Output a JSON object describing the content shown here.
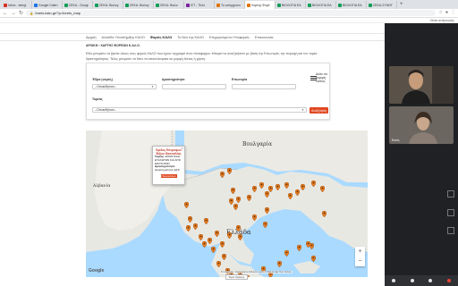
{
  "browser": {
    "tabs": [
      {
        "label": "Inbox - stergi",
        "color": "#d93025"
      },
      {
        "label": "Google Calen",
        "color": "#1a73e8"
      },
      {
        "label": "ΣΕΚΑ - Googl",
        "color": "#0f9d58"
      },
      {
        "label": "ΣΕΚΑ: Βιολογ",
        "color": "#0f9d58"
      },
      {
        "label": "ΣΕΚΑ: Βιολογ",
        "color": "#0f9d58"
      },
      {
        "label": "ΣΕΚΑ: Βιολο",
        "color": "#0f9d58"
      },
      {
        "label": "ΙΣΤ - Τίτλο",
        "color": "#7b1fa2"
      },
      {
        "label": "Το ασύγχρονο",
        "color": "#e37400"
      },
      {
        "label": "Χάρτης Φορέ",
        "color": "#e37400",
        "active": true
      },
      {
        "label": "ΒΙΟΛΟΓΙΑ ΕΑ",
        "color": "#0f9d58"
      },
      {
        "label": "ΒΙΟΛΟΓΙΑ ΕΑ",
        "color": "#0f9d58"
      },
      {
        "label": "ΒΙΟΛΟΓΙΑ ΕΑ",
        "color": "#0f9d58"
      },
      {
        "label": "ΣΕΚΑ-ΣΥΝΟΓ",
        "color": "#0f9d58"
      }
    ],
    "new_tab": "+",
    "url": "foreis.kalo.gr/?p=foreis_map",
    "bookmark": "Λίστα ανάγνωσης"
  },
  "site": {
    "menu": [
      "Αρχική",
      "Αλυσίδα Υποστήριξης ΚΑΛΟ",
      "Φορείς ΚΑΛΟ",
      "Το Νέο της ΚΑΛΟ",
      "Επιχειρούμενοι Υποφορείς",
      "Επικοινωνία"
    ],
    "active_menu": "Φορείς ΚΑΛΟ",
    "breadcrumb": "ΑΡΧΙΚΗ › ΧΑΡΤΗΣ ΦΟΡΕΩΝ Κ.ΑΛ.Ο.",
    "intro": "Εδώ μπορείτε να βρείτε όλους τους φορείς ΚΑΛΟ που έχουν εγγραφεί στον πλατφόρμα. Μπορεί να αναζητήσετε με βάση την Επωνυμία, την περιοχή και τον τομέα δραστηριότητας. Τέλος μπορείτε να δείτε τα αποτελέσματα σε μορφή λίστας ή χάρτη."
  },
  "filter": {
    "region_label": "Έδρα (νομός)",
    "region_value": "--Οποιαδήποτε--",
    "activity_label": "Δραστηριότητα",
    "activity_value": "",
    "name_label": "Επωνυμία",
    "name_value": "",
    "sector_label": "Τομέας",
    "sector_value": "--Οποιαδήποτε--",
    "search_button": "Αναζήτηση",
    "list_view": "Δείτε σε μορφή λίστας"
  },
  "map": {
    "labels": {
      "bulgaria": "Βουλγαρία",
      "albania": "Αλβανία",
      "greece": "Ελλάδα"
    },
    "popup": {
      "title": "Ομιλος Εκτροφών Βιζων Θεσσαλίας",
      "sector_label": "Τομέας:",
      "sector_value": "ΕΠΑΝΤΑΞΗ ΕΥΑΛΩΤΩΝ ΚΑΙ ΑΠΟ ΕΝΟΤΗΤΩΝ",
      "activity_label": "Δραστηριότητα:",
      "activity_value": "Δραστηριότητες ΕΚΚ",
      "button": "Περισσότερα",
      "close": "×"
    },
    "map_button": "Όροι Χρήσης",
    "google": "Google",
    "attribution": "Συντομεύσεις πληκτρολογίου  Δεδομένα χάρτη ©2021 Google  Όροι Χρήσης",
    "zoom_in": "+",
    "zoom_out": "−",
    "pin_color": "#e67e22"
  },
  "meet": {
    "participants": [
      {
        "name": "Παρουσιαστής"
      },
      {
        "name": "Εσείς"
      }
    ]
  }
}
